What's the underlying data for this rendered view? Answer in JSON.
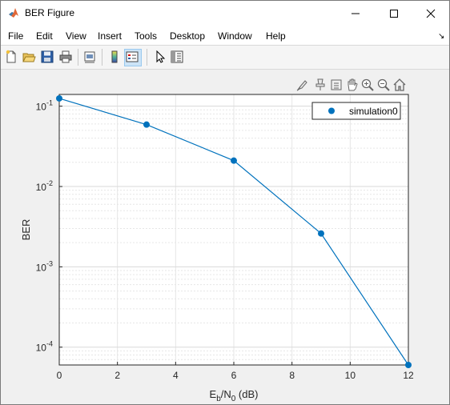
{
  "window": {
    "title": "BER Figure"
  },
  "menu": {
    "items": [
      "File",
      "Edit",
      "View",
      "Insert",
      "Tools",
      "Desktop",
      "Window",
      "Help"
    ]
  },
  "toolbar": {
    "icons": [
      "new-figure-icon",
      "open-file-icon",
      "save-icon",
      "print-icon",
      "print-preview-icon",
      "colorbar-icon",
      "legend-icon",
      "edit-plot-icon",
      "property-inspector-icon"
    ]
  },
  "axes_toolbar": {
    "icons": [
      "brush-icon",
      "data-tips-icon",
      "restore-view-icon",
      "pan-icon",
      "zoom-in-icon",
      "zoom-out-icon",
      "home-icon"
    ]
  },
  "colors": {
    "series": "#0072bd",
    "grid": "#e6e6e6",
    "axes_bg": "#ffffff",
    "figure_bg": "#f0f0f0"
  },
  "chart_data": {
    "type": "line",
    "title": "",
    "xlabel_parts": [
      "E",
      "b",
      "/N",
      "0",
      " (dB)"
    ],
    "ylabel": "BER",
    "xlim": [
      0,
      12
    ],
    "ylim": [
      6e-05,
      0.14
    ],
    "yscale": "log",
    "xticks": [
      0,
      2,
      4,
      6,
      8,
      10,
      12
    ],
    "yticks": [
      {
        "value": 0.1,
        "base": "10",
        "exp": "-1"
      },
      {
        "value": 0.01,
        "base": "10",
        "exp": "-2"
      },
      {
        "value": 0.001,
        "base": "10",
        "exp": "-3"
      },
      {
        "value": 0.0001,
        "base": "10",
        "exp": "-4"
      }
    ],
    "grid": true,
    "minor_grid": true,
    "legend_position": "top-right",
    "series": [
      {
        "name": "simulation0",
        "x": [
          0,
          3,
          6,
          9,
          12
        ],
        "y": [
          0.125,
          0.059,
          0.021,
          0.0026,
          6e-05
        ]
      }
    ]
  }
}
